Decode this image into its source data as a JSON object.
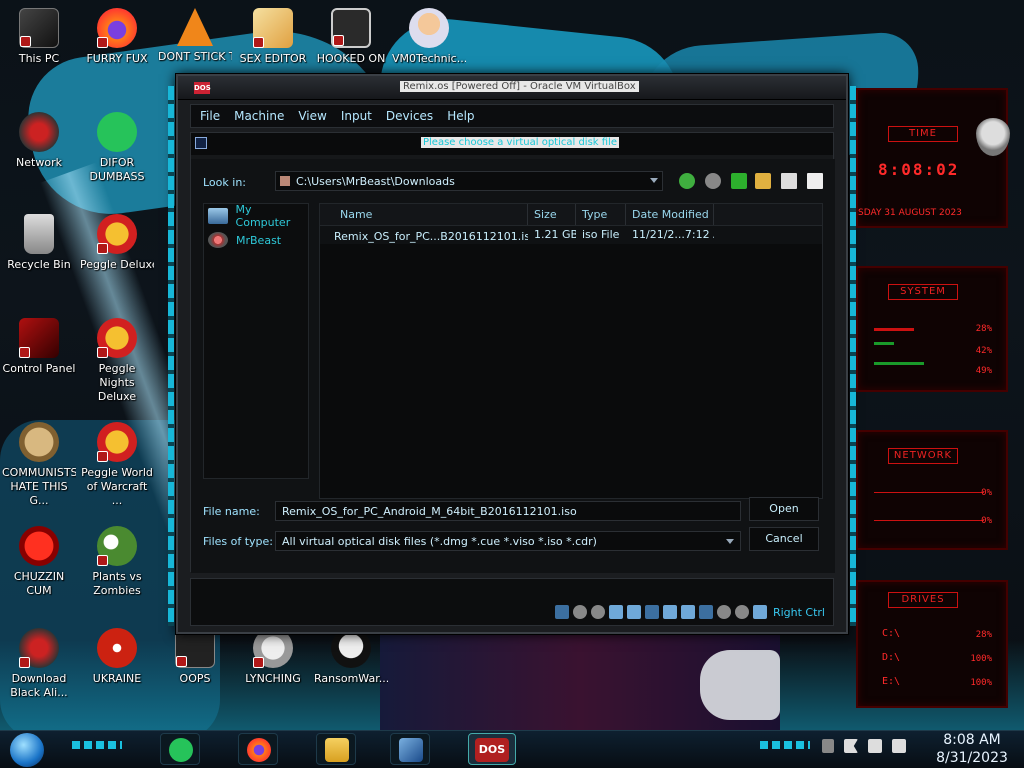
{
  "desktop": {
    "icons": [
      {
        "label": "This PC",
        "icon": "this-pc-icon"
      },
      {
        "label": "FURRY FUX",
        "icon": "firefox-icon"
      },
      {
        "label": "DONT STICK T",
        "icon": "vlc-icon"
      },
      {
        "label": "SEX EDITOR",
        "icon": "xd-icon"
      },
      {
        "label": "HOOKED ON",
        "icon": "maze-icon"
      },
      {
        "label": "VM0Technic...",
        "icon": "doctor-icon"
      },
      {
        "label": "Network",
        "icon": "network-icon"
      },
      {
        "label": "DIFOR DUMBASS",
        "icon": "spotify-icon"
      },
      {
        "label": "Recycle Bin",
        "icon": "recycle-bin-icon"
      },
      {
        "label": "Peggle Deluxe",
        "icon": "peggle-icon"
      },
      {
        "label": "Control Panel",
        "icon": "control-panel-icon"
      },
      {
        "label": "Peggle Nights Deluxe",
        "icon": "peggle-nights-icon"
      },
      {
        "label": "COMMUNISTS HATE THIS G...",
        "icon": "money-bag-icon"
      },
      {
        "label": "Peggle World of Warcraft ...",
        "icon": "peggle-wow-icon"
      },
      {
        "label": "CHUZZIN CUM",
        "icon": "chuzzle-icon"
      },
      {
        "label": "Plants vs Zombies",
        "icon": "pvz-icon"
      },
      {
        "label": "Download Black Ali...",
        "icon": "alienware-icon"
      },
      {
        "label": "UKRAINE",
        "icon": "radiation-icon"
      },
      {
        "label": "OOPS",
        "icon": "oops-icon"
      },
      {
        "label": "LYNCHING",
        "icon": "lynching-icon"
      },
      {
        "label": "RansomWar...",
        "icon": "skull-icon"
      }
    ]
  },
  "vm_window": {
    "title": "Remix.os [Powered Off] - Oracle VM VirtualBox",
    "logo_text": "DOS",
    "menu": [
      "File",
      "Machine",
      "View",
      "Input",
      "Devices",
      "Help"
    ],
    "status_host_key": "Right Ctrl"
  },
  "dialog": {
    "title": "Please choose a virtual optical disk file",
    "look_in_label": "Look in:",
    "look_in_path": "C:\\Users\\MrBeast\\Downloads",
    "sidebar": [
      {
        "label": "My Computer"
      },
      {
        "label": "MrBeast"
      }
    ],
    "columns": [
      "Name",
      "Size",
      "Type",
      "Date Modified"
    ],
    "files": [
      {
        "name": "Remix_OS_for_PC...B2016112101.iso",
        "size": "1.21 GB",
        "type": "iso File",
        "date": "11/21/2...7:12 AM"
      }
    ],
    "file_name_label": "File name:",
    "file_name_value": "Remix_OS_for_PC_Android_M_64bit_B2016112101.iso",
    "file_type_label": "Files of type:",
    "file_type_value": "All virtual optical disk files (*.dmg *.cue *.viso *.iso *.cdr)",
    "open_label": "Open",
    "cancel_label": "Cancel"
  },
  "gadgets": {
    "time_title": "TIME",
    "time_value": "8:08:02",
    "date_value": "SDAY 31 AUGUST 2023",
    "system_title": "SYSTEM",
    "system_values": [
      "28%",
      "42%",
      "49%"
    ],
    "network_title": "NETWORK",
    "network_values": [
      "0%",
      "0%"
    ],
    "drives_title": "DRIVES",
    "drives": [
      {
        "letter": "C:\\",
        "value": "28%"
      },
      {
        "letter": "D:\\",
        "value": "100%"
      },
      {
        "letter": "E:\\",
        "value": "100%"
      }
    ]
  },
  "taskbar": {
    "apps": [
      "spotify-icon",
      "firefox-icon",
      "file-explorer-icon",
      "virtualbox-icon",
      "dos-icon"
    ],
    "active_app_label": "DOS",
    "time": "8:08 AM",
    "date": "8/31/2023"
  }
}
